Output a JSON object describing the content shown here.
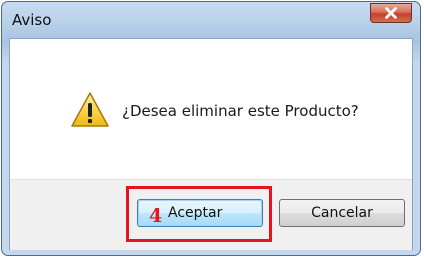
{
  "window": {
    "title": "Aviso",
    "close_icon": "close-x-icon"
  },
  "dialog": {
    "icon": "warning-icon",
    "message": "¿Desea eliminar este Producto?"
  },
  "buttons": {
    "accept_label": "Aceptar",
    "cancel_label": "Cancelar"
  },
  "annotation": {
    "step_number": "4",
    "color": "#e8141b"
  }
}
